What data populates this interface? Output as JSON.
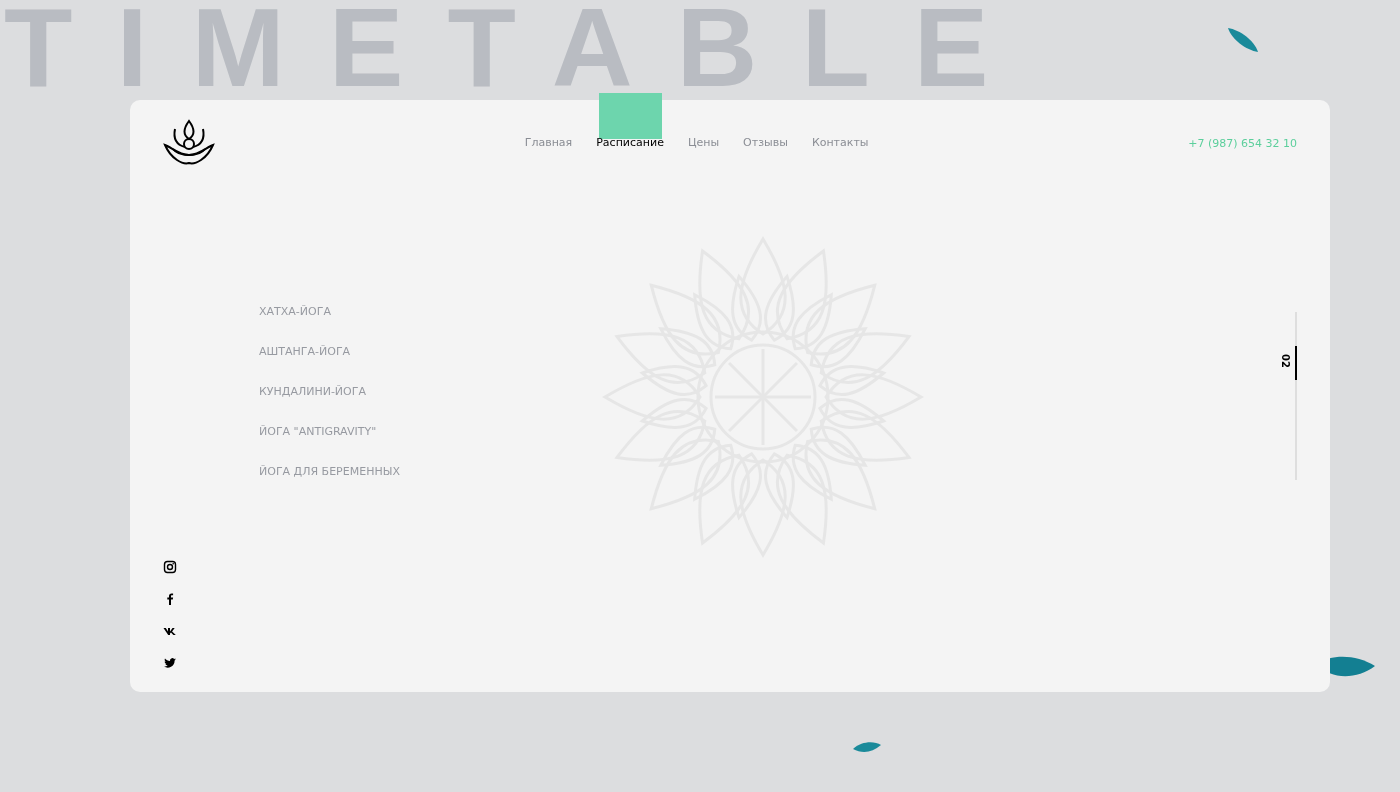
{
  "backdrop_title": "TIMETABLE",
  "nav": [
    {
      "label": "Главная",
      "selected": false
    },
    {
      "label": "Расписание",
      "selected": true
    },
    {
      "label": "Цены",
      "selected": false
    },
    {
      "label": "Отзывы",
      "selected": false
    },
    {
      "label": "Контакты",
      "selected": false
    }
  ],
  "phone": "+7 (987) 654 32 10",
  "classes": [
    "ХАТХА-ЙОГА",
    "АШТАНГА-ЙОГА",
    "КУНДАЛИНИ-ЙОГА",
    "ЙОГА \"ANTIGRAVITY\"",
    "ЙОГА ДЛЯ БЕРЕМЕННЫХ"
  ],
  "social": [
    {
      "kind": "instagram"
    },
    {
      "kind": "facebook"
    },
    {
      "kind": "vk"
    },
    {
      "kind": "twitter"
    }
  ],
  "page_indicator": {
    "number": "02",
    "level": 0.2
  }
}
